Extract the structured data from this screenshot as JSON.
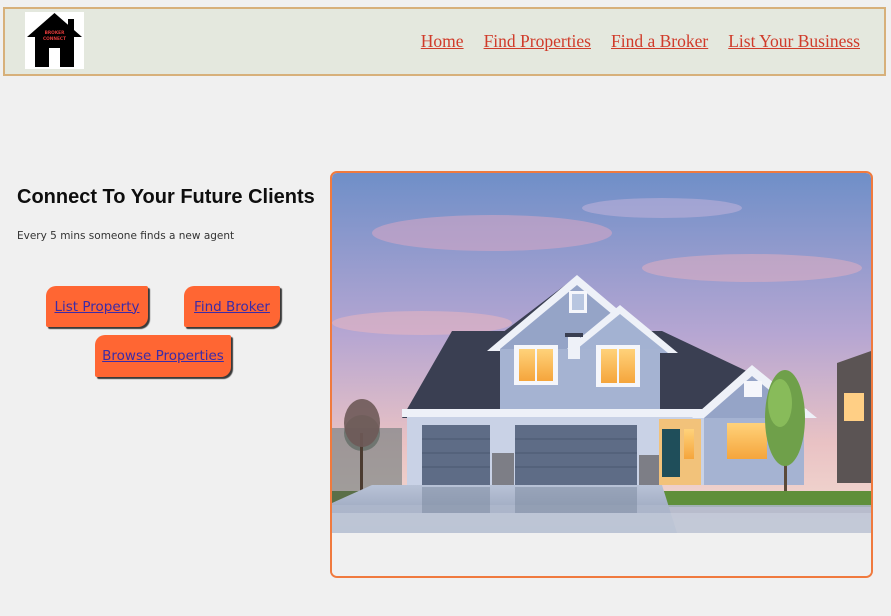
{
  "logo": {
    "text_line1": "BROKER",
    "text_line2": "CONNECT"
  },
  "nav": {
    "links": [
      {
        "label": "Home"
      },
      {
        "label": "Find Properties"
      },
      {
        "label": "Find a Broker"
      },
      {
        "label": "List Your Business"
      }
    ]
  },
  "hero": {
    "title": "Connect To Your Future Clients",
    "subtitle": "Every 5 mins someone finds a new agent",
    "buttons": {
      "list_property": "List Property",
      "find_broker": "Find Broker",
      "browse_properties": "Browse Properties"
    }
  },
  "colors": {
    "nav_bg": "#e4e8de",
    "nav_border": "#d7b07a",
    "link": "#d03b2a",
    "button_bg": "#ff6633",
    "button_text": "#3b2ba8",
    "image_border": "#f07a3e"
  }
}
